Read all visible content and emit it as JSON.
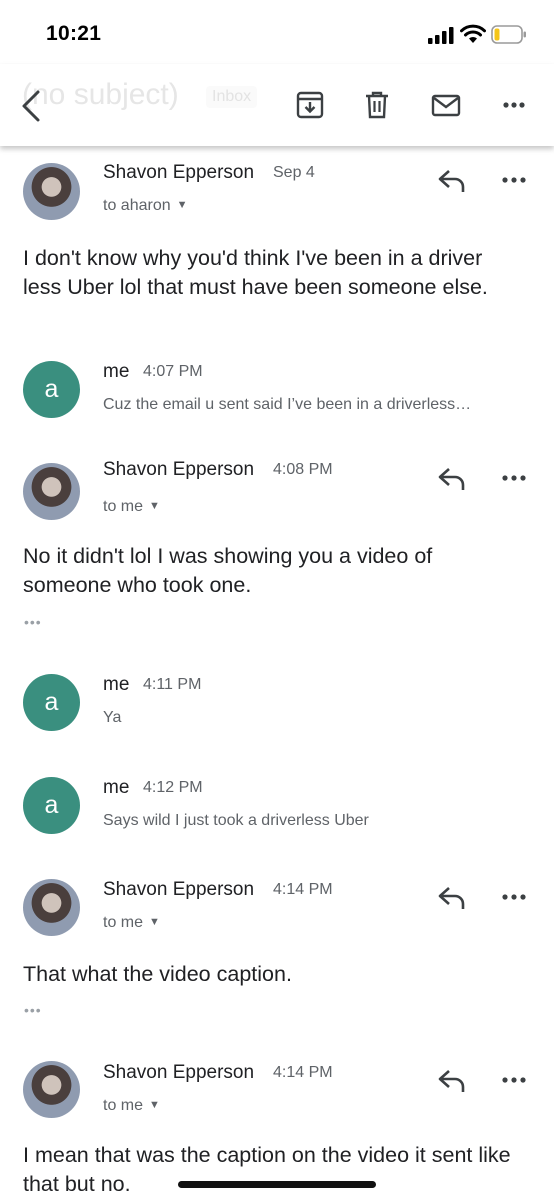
{
  "status_bar": {
    "time": "10:21"
  },
  "app_bar": {
    "subject": "(no subject)",
    "label_chip": "Inbox",
    "icons": [
      "back-arrow-icon",
      "archive-icon",
      "trash-icon",
      "mail-icon",
      "more-vert-icon"
    ]
  },
  "messages": [
    {
      "sender": "Shavon Epperson",
      "date": "Sep 4",
      "recipient": "to aharon",
      "body": "I don't know why you'd think I've been in a driver less Uber lol  that must have been someone else."
    },
    {
      "sender": "me",
      "avatar_letter": "a",
      "date": "4:07 PM",
      "snippet": "Cuz the email u sent said I’ve been in a driverless…"
    },
    {
      "sender": "Shavon Epperson",
      "date": "4:08 PM",
      "recipient": "to me",
      "body": "No it didn't lol I was showing you a video of someone who took one.",
      "ellipsis": "•••"
    },
    {
      "sender": "me",
      "avatar_letter": "a",
      "date": "4:11 PM",
      "snippet": "Ya"
    },
    {
      "sender": "me",
      "avatar_letter": "a",
      "date": "4:12 PM",
      "snippet": "Says wild I just took a driverless Uber"
    },
    {
      "sender": "Shavon Epperson",
      "date": "4:14 PM",
      "recipient": "to me",
      "body": "That what the video caption.",
      "ellipsis": "•••"
    },
    {
      "sender": "Shavon Epperson",
      "date": "4:14 PM",
      "recipient": "to me",
      "body": "I mean that was the caption on the video it sent like that but no."
    }
  ],
  "colors": {
    "avatar_me": "#3a8f7f",
    "text_primary": "#202124",
    "text_secondary": "#5f6368"
  }
}
